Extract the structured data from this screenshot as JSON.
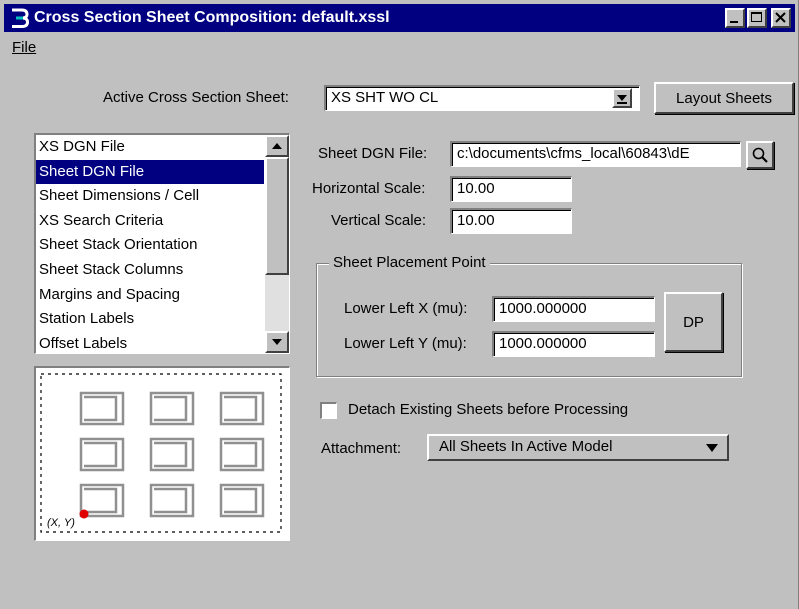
{
  "window": {
    "title": "Cross Section Sheet Composition: default.xssl",
    "icon": "bentley-b-icon"
  },
  "menu": {
    "file_label": "File"
  },
  "active_sheet": {
    "label": "Active Cross Section Sheet:",
    "value": "XS SHT WO CL",
    "layout_button": "Layout Sheets"
  },
  "categories": {
    "items": [
      "XS DGN File",
      "Sheet DGN File",
      "Sheet Dimensions / Cell",
      "XS Search Criteria",
      "Sheet Stack Orientation",
      "Sheet Stack Columns",
      "Margins and Spacing",
      "Station Labels",
      "Offset Labels"
    ],
    "selected_index": 1
  },
  "preview": {
    "origin_label": "(X, Y)",
    "point_color": "#e00000"
  },
  "sheet": {
    "dgn_label": "Sheet DGN File:",
    "dgn_value": "c:\\documents\\cfms_local\\60843\\dE",
    "hscale_label": "Horizontal Scale:",
    "hscale_value": "10.00",
    "vscale_label": "Vertical Scale:",
    "vscale_value": "10.00"
  },
  "placement": {
    "group_label": "Sheet Placement Point",
    "x_label": "Lower Left X (mu):",
    "x_value": "1000.000000",
    "y_label": "Lower Left Y (mu):",
    "y_value": "1000.000000",
    "dp_button": "DP"
  },
  "options": {
    "detach_label": "Detach Existing Sheets before Processing",
    "detach_checked": false,
    "attachment_label": "Attachment:",
    "attachment_value": "All Sheets In Active Model"
  },
  "colors": {
    "titlebar": "#000080",
    "selection": "#000080",
    "face": "#c0c0c0"
  }
}
